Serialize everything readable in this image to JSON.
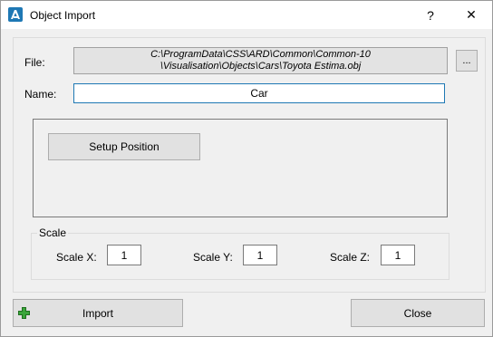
{
  "window": {
    "title": "Object Import",
    "help_label": "?",
    "close_label": "✕"
  },
  "form": {
    "file_label": "File:",
    "file_path_line1": "C:\\ProgramData\\CSS\\ARD\\Common\\Common-10",
    "file_path_line2": "\\Visualisation\\Objects\\Cars\\Toyota Estima.obj",
    "browse_label": "...",
    "name_label": "Name:",
    "name_value": "Car"
  },
  "position": {
    "setup_label": "Setup Position"
  },
  "scale": {
    "title": "Scale",
    "x_label": "Scale X:",
    "x_value": "1",
    "y_label": "Scale Y:",
    "y_value": "1",
    "z_label": "Scale Z:",
    "z_value": "1"
  },
  "buttons": {
    "import_label": "Import",
    "close_label": "Close"
  },
  "icons": {
    "app": "app-logo-icon",
    "import": "plus-icon"
  },
  "colors": {
    "accent": "#1e78b4",
    "plus_green": "#3aa53a",
    "dialog_bg": "#f0f0f0"
  }
}
